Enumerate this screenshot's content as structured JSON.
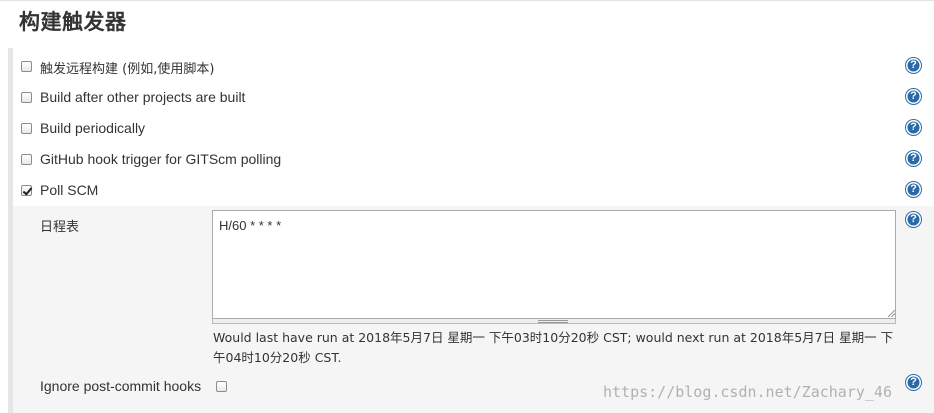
{
  "section": {
    "title": "构建触发器"
  },
  "triggers": [
    {
      "label": "触发远程构建 (例如,使用脚本)",
      "checked": false
    },
    {
      "label": "Build after other projects are built",
      "checked": false
    },
    {
      "label": "Build periodically",
      "checked": false
    },
    {
      "label": "GitHub hook trigger for GITScm polling",
      "checked": false
    },
    {
      "label": "Poll SCM",
      "checked": true
    }
  ],
  "poll_scm": {
    "schedule_label": "日程表",
    "schedule_value": "H/60 * * * *",
    "schedule_info": "Would last have run at 2018年5月7日 星期一 下午03时10分20秒 CST; would next run at 2018年5月7日 星期一 下午04时10分20秒 CST.",
    "ignore_hooks_label": "Ignore post-commit hooks",
    "ignore_hooks_checked": false
  },
  "help_icon_glyph": "?",
  "watermark": "https://blog.csdn.net/Zachary_46",
  "colors": {
    "help_icon": "#2a6aa8",
    "nested_bg": "#f5f5f5"
  }
}
